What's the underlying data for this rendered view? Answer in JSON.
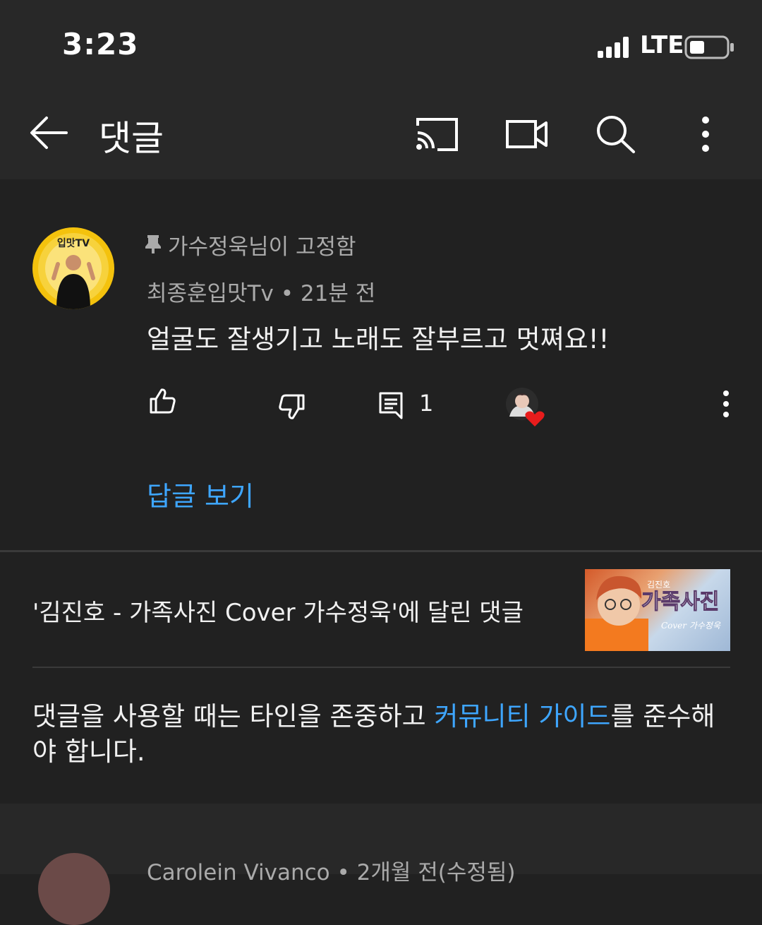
{
  "status_bar": {
    "time": "3:23",
    "network": "LTE"
  },
  "app_bar": {
    "title": "댓글",
    "icons": [
      "back-arrow-icon",
      "cast-icon",
      "video-camera-icon",
      "search-icon",
      "more-vert-icon"
    ]
  },
  "pinned_comment": {
    "pinned_label": "가수정욱님이 고정함",
    "author": "최종훈입맛Tv",
    "time": "21분 전",
    "text": "얼굴도 잘생기고 노래도 잘부르고 멋쪄요!!",
    "reply_count": "1",
    "view_replies": "답글 보기",
    "avatar_label": "입맛TV"
  },
  "video_info": {
    "text": "'김진호 - 가족사진 Cover 가수정욱'에 달린 댓글",
    "thumbnail_title": "가족사진",
    "thumbnail_small": "김진호",
    "thumbnail_sub": "Cover 가수정욱"
  },
  "guideline": {
    "before": "댓글을 사용할 때는 타인을 존중하고 ",
    "link": "커뮤니티 가이드",
    "after": "를 준수해야 합니다."
  },
  "next_comment": {
    "author": "Carolein Vivanco",
    "time": "2개월 전(수정됨)"
  },
  "colors": {
    "background": "#212121",
    "bar": "#282828",
    "link": "#3ea6ff",
    "secondary_text": "#aaaaaa"
  }
}
